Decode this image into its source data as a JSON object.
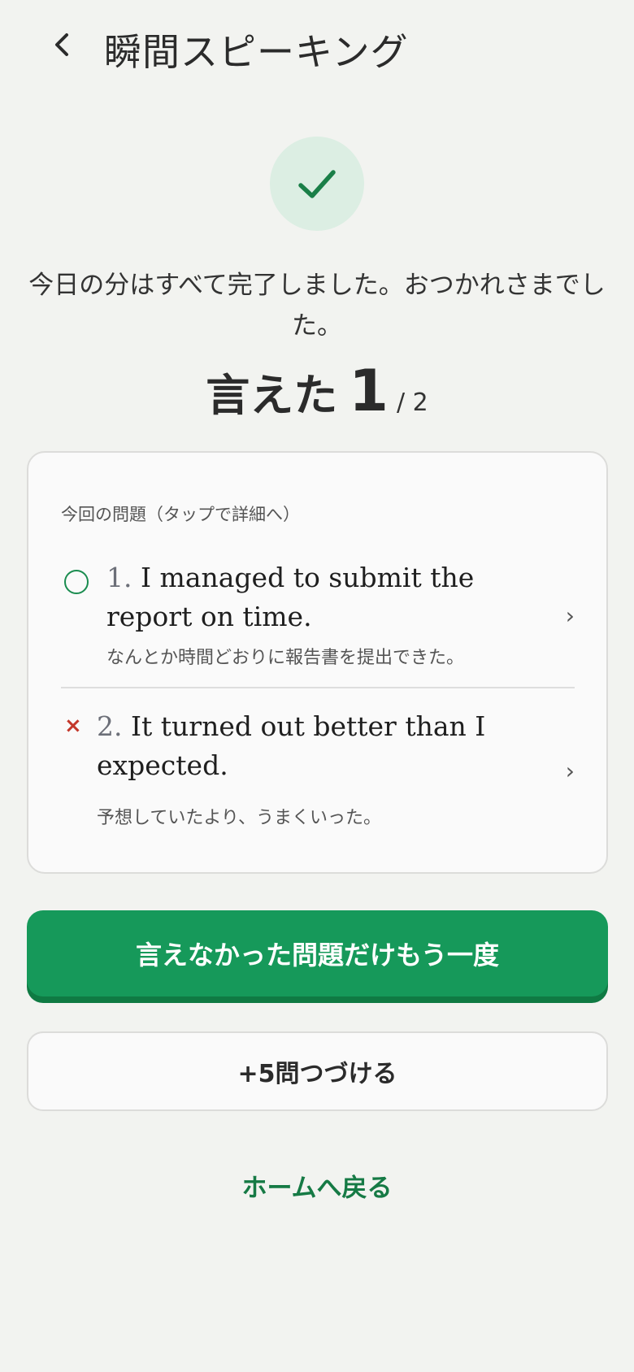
{
  "header": {
    "title": "瞬間スピーキング",
    "back_icon": "chevron-left-icon"
  },
  "status": {
    "icon": "check-icon",
    "message": "今日の分はすべて完了しました。おつかれさまでした。"
  },
  "score": {
    "label": "言えた",
    "correct": "1",
    "total": "/ 2"
  },
  "questions": {
    "caption": "今回の問題（タップで詳細へ）",
    "items": [
      {
        "result": "correct",
        "number": "1.",
        "english": "I managed to submit the report on time.",
        "japanese": "なんとか時間どおりに報告書を提出できた。"
      },
      {
        "result": "incorrect",
        "number": "2.",
        "english": "It turned out better than I expected.",
        "japanese": "予想していたより、うまくいった。"
      }
    ]
  },
  "actions": {
    "retry_label": "言えなかった問題だけもう一度",
    "more_label": "+5問つづける",
    "home_label": "ホームへ戻る"
  },
  "colors": {
    "accent": "#16995a",
    "correct": "#1a8c4f",
    "incorrect": "#c4382b",
    "background": "#f2f3f0"
  }
}
